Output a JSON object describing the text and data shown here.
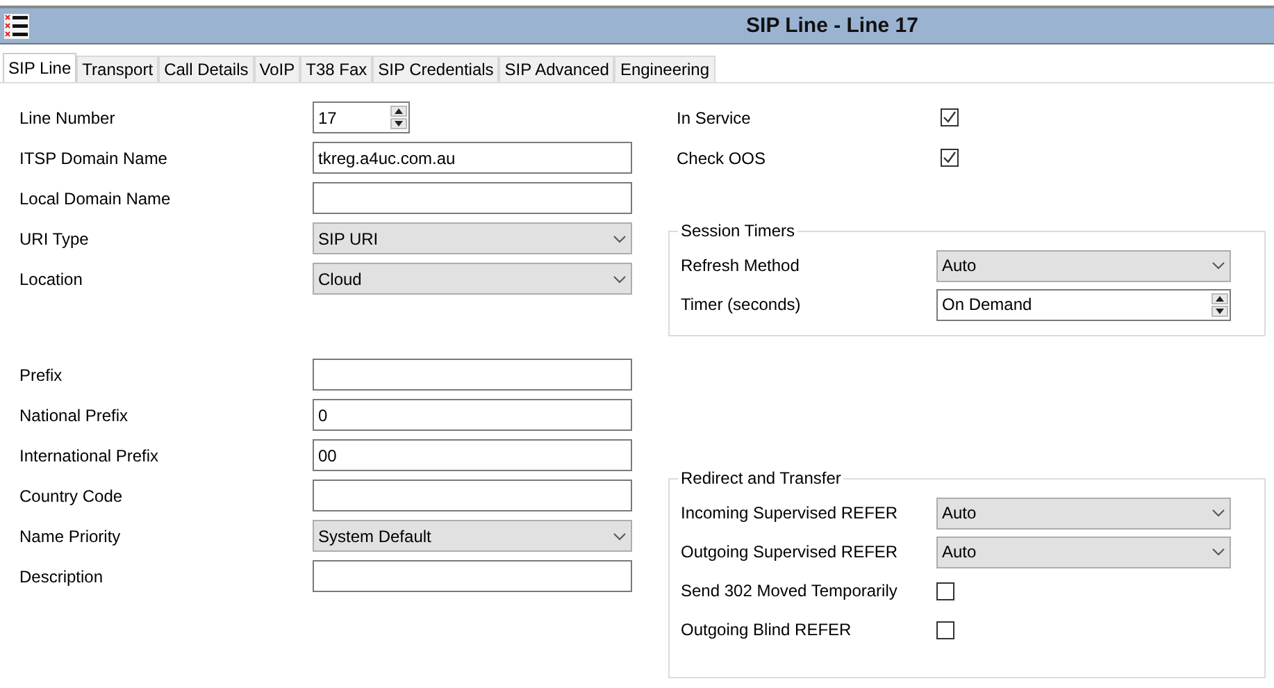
{
  "window": {
    "title": "SIP Line - Line 17"
  },
  "tabs": [
    {
      "label": "SIP Line",
      "selected": true
    },
    {
      "label": "Transport",
      "selected": false
    },
    {
      "label": "Call Details",
      "selected": false
    },
    {
      "label": "VoIP",
      "selected": false
    },
    {
      "label": "T38 Fax",
      "selected": false
    },
    {
      "label": "SIP Credentials",
      "selected": false
    },
    {
      "label": "SIP Advanced",
      "selected": false
    },
    {
      "label": "Engineering",
      "selected": false
    }
  ],
  "left_groups": [
    [
      {
        "label": "Line Number",
        "kind": "spin",
        "value": "17"
      },
      {
        "label": "ITSP Domain Name",
        "kind": "text",
        "value": "tkreg.a4uc.com.au"
      },
      {
        "label": "Local Domain Name",
        "kind": "text"
      },
      {
        "label": "URI Type",
        "kind": "select",
        "value": "SIP URI"
      },
      {
        "label": "Location",
        "kind": "select",
        "value": "Cloud"
      }
    ],
    [
      {
        "label": "Prefix",
        "kind": "text"
      },
      {
        "label": "National Prefix",
        "kind": "text",
        "value": "0"
      },
      {
        "label": "International Prefix",
        "kind": "text",
        "value": "00"
      },
      {
        "label": "Country Code",
        "kind": "text"
      },
      {
        "label": "Name Priority",
        "kind": "select",
        "value": "System Default"
      },
      {
        "label": "Description",
        "kind": "text"
      }
    ]
  ],
  "right_fields": [
    {
      "label": "In Service",
      "kind": "checkbox",
      "checked": true
    },
    {
      "label": "Check OOS",
      "kind": "checkbox",
      "checked": true
    }
  ],
  "session_timers": {
    "title": "Session Timers",
    "fields": [
      {
        "label": "Refresh  Method",
        "kind": "select",
        "value": "Auto"
      },
      {
        "label": "Timer (seconds)",
        "kind": "spin",
        "value": "On Demand"
      }
    ]
  },
  "redirect_and_transfer": {
    "title": "Redirect and Transfer",
    "fields": [
      {
        "label": "Incoming Supervised REFER",
        "kind": "select",
        "value": "Auto"
      },
      {
        "label": "Outgoing Supervised REFER",
        "kind": "select",
        "value": "Auto"
      },
      {
        "label": "Send 302 Moved Temporarily",
        "kind": "checkbox",
        "checked": false
      },
      {
        "label": "Outgoing Blind REFER",
        "kind": "checkbox",
        "checked": false
      }
    ]
  }
}
